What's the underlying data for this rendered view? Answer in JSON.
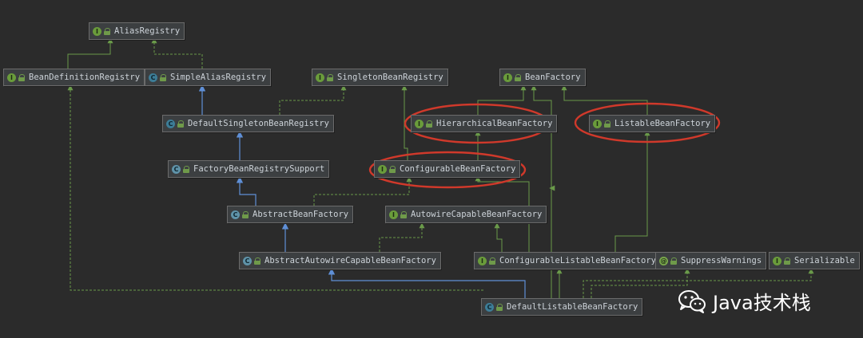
{
  "nodes": [
    {
      "id": "alias",
      "label": "AliasRegistry",
      "kind": "interface"
    },
    {
      "id": "bdr",
      "label": "BeanDefinitionRegistry",
      "kind": "interface"
    },
    {
      "id": "sar",
      "label": "SimpleAliasRegistry",
      "kind": "class"
    },
    {
      "id": "sbr",
      "label": "SingletonBeanRegistry",
      "kind": "interface"
    },
    {
      "id": "bf",
      "label": "BeanFactory",
      "kind": "interface"
    },
    {
      "id": "dsbr",
      "label": "DefaultSingletonBeanRegistry",
      "kind": "class"
    },
    {
      "id": "hbf",
      "label": "HierarchicalBeanFactory",
      "kind": "interface"
    },
    {
      "id": "lbf",
      "label": "ListableBeanFactory",
      "kind": "interface"
    },
    {
      "id": "fbrs",
      "label": "FactoryBeanRegistrySupport",
      "kind": "abstract"
    },
    {
      "id": "cbf",
      "label": "ConfigurableBeanFactory",
      "kind": "interface"
    },
    {
      "id": "abf",
      "label": "AbstractBeanFactory",
      "kind": "abstract"
    },
    {
      "id": "acbf",
      "label": "AutowireCapableBeanFactory",
      "kind": "interface"
    },
    {
      "id": "aacbf",
      "label": "AbstractAutowireCapableBeanFactory",
      "kind": "abstract"
    },
    {
      "id": "clbf",
      "label": "ConfigurableListableBeanFactory",
      "kind": "interface"
    },
    {
      "id": "sw",
      "label": "SuppressWarnings",
      "kind": "annotation"
    },
    {
      "id": "ser",
      "label": "Serializable",
      "kind": "interface"
    },
    {
      "id": "dlbf",
      "label": "DefaultListableBeanFactory",
      "kind": "class"
    }
  ],
  "icons": {
    "interface": "I",
    "class": "C",
    "abstract": "C",
    "annotation": "@"
  },
  "highlighted": [
    "hbf",
    "lbf",
    "cbf"
  ],
  "colors": {
    "extends": "#5f8fd6",
    "implements": "#6a9a4a",
    "highlight": "#d0392b"
  },
  "edges": [
    {
      "from": "bdr",
      "to": "alias",
      "type": "interface-extends"
    },
    {
      "from": "sar",
      "to": "alias",
      "type": "implements"
    },
    {
      "from": "dsbr",
      "to": "sar",
      "type": "extends"
    },
    {
      "from": "dsbr",
      "to": "sbr",
      "type": "implements"
    },
    {
      "from": "fbrs",
      "to": "dsbr",
      "type": "extends"
    },
    {
      "from": "abf",
      "to": "fbrs",
      "type": "extends"
    },
    {
      "from": "abf",
      "to": "cbf",
      "type": "implements"
    },
    {
      "from": "aacbf",
      "to": "abf",
      "type": "extends"
    },
    {
      "from": "aacbf",
      "to": "acbf",
      "type": "implements"
    },
    {
      "from": "dlbf",
      "to": "aacbf",
      "type": "extends"
    },
    {
      "from": "dlbf",
      "to": "bdr",
      "type": "implements"
    },
    {
      "from": "dlbf",
      "to": "clbf",
      "type": "implements"
    },
    {
      "from": "dlbf",
      "to": "ser",
      "type": "implements"
    },
    {
      "from": "hbf",
      "to": "bf",
      "type": "interface-extends"
    },
    {
      "from": "lbf",
      "to": "bf",
      "type": "interface-extends"
    },
    {
      "from": "acbf",
      "to": "bf",
      "type": "interface-extends"
    },
    {
      "from": "cbf",
      "to": "hbf",
      "type": "interface-extends"
    },
    {
      "from": "cbf",
      "to": "sbr",
      "type": "interface-extends"
    },
    {
      "from": "clbf",
      "to": "cbf",
      "type": "interface-extends"
    },
    {
      "from": "clbf",
      "to": "lbf",
      "type": "interface-extends"
    },
    {
      "from": "clbf",
      "to": "acbf",
      "type": "interface-extends"
    }
  ],
  "watermark": {
    "text": "Java技术栈",
    "icon": "wechat-icon"
  }
}
